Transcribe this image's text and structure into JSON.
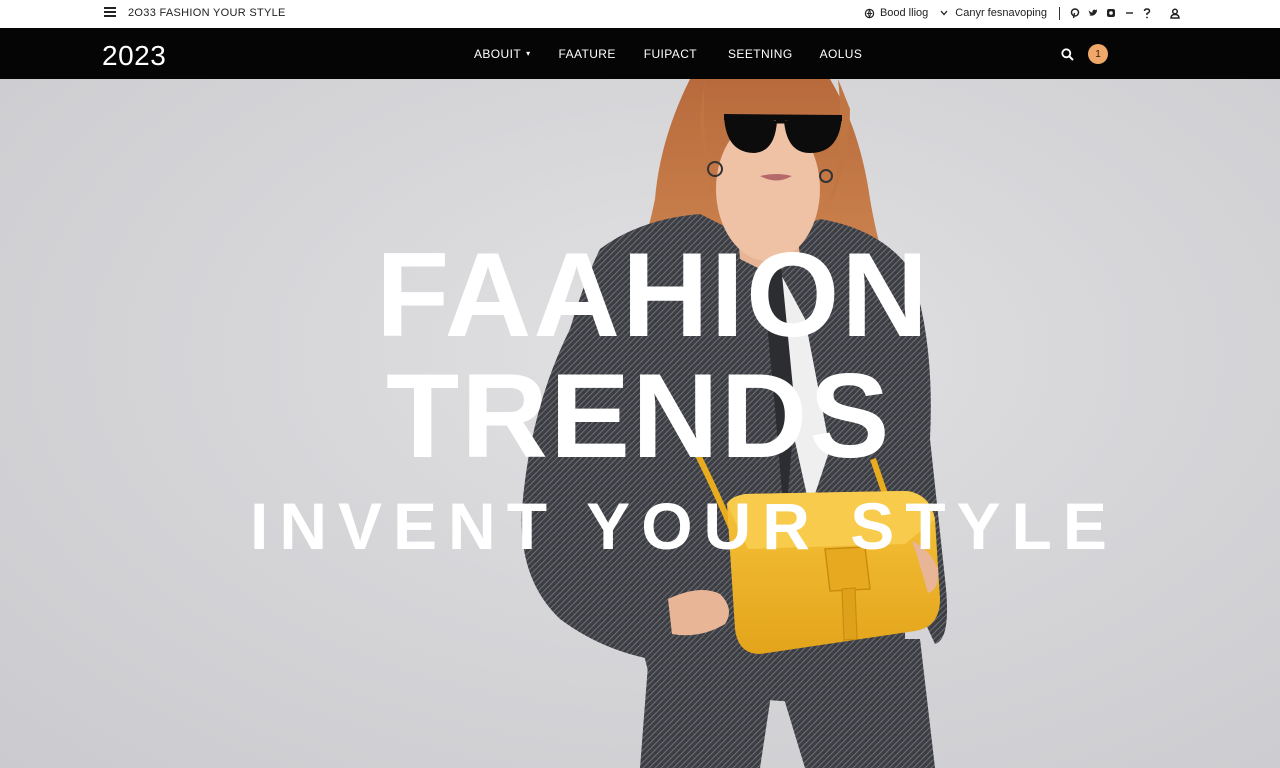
{
  "topbar": {
    "site_tag": "2O33 FASHION YOUR STYLE",
    "link_blog": "Bood lliog",
    "link_shop": "Canyr fesnavoping",
    "social_icons": [
      "pinterest-icon",
      "twitter-icon",
      "instagram-icon",
      "more-icon",
      "help-icon"
    ]
  },
  "navbar": {
    "logo": "2023",
    "links": [
      {
        "label": "ABOUIT",
        "has_caret": true
      },
      {
        "label": "FAATURE"
      },
      {
        "label": "FUIPACT"
      },
      {
        "label": "SEETNING"
      },
      {
        "label": "AOLUS"
      }
    ],
    "caret": "▾",
    "cart_count": "1",
    "badge_color": "#f0a76a"
  },
  "hero": {
    "line1": "FAAHION",
    "line2": "TRENDS",
    "line3": "INVENT YOUR STYLE",
    "accent_bag_color": "#f2b623",
    "coat_color": "#3d3f44",
    "background_color": "#d6d6d9"
  }
}
